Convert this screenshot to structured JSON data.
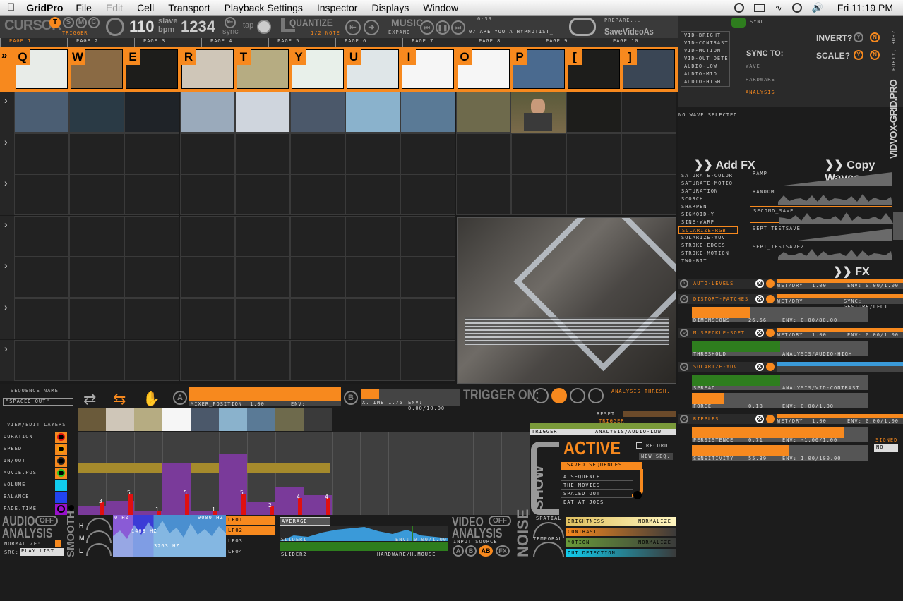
{
  "menubar": {
    "app": "GridPro",
    "items": [
      "File",
      "Edit",
      "Cell",
      "Transport",
      "Playback Settings",
      "Inspector",
      "Displays",
      "Window"
    ],
    "clock": "Fri 11:19 PM"
  },
  "toolbar": {
    "cursor": "CURSOR",
    "modes": [
      "T",
      "S",
      "M",
      "C"
    ],
    "trigger": "TRIGGER",
    "bpm": "110",
    "bpm_units": "slave\nbpm",
    "beats": "1234",
    "sync": "sync",
    "tap": "tap",
    "quantize": "QUANTIZE",
    "quantize_val": "1/2 NOTE",
    "music": "MUSIC",
    "expand": "EXPAND",
    "time": "0:39",
    "track": "07 ARE YOU A HYPNOTIST_",
    "prepare": "PREPARE...",
    "save": "SaveVideoAs"
  },
  "pages": [
    "PAGE 1",
    "PAGE 2",
    "PAGE 3",
    "PAGE 4",
    "PAGE 5",
    "PAGE 6",
    "PAGE 7",
    "PAGE 8",
    "PAGE 9",
    "PAGE 10"
  ],
  "row1_keys": [
    "Q",
    "W",
    "E",
    "R",
    "T",
    "Y",
    "U",
    "I",
    "O",
    "P",
    "[",
    "]"
  ],
  "rows": [
    "2",
    "3",
    "4",
    "5",
    "6",
    "7",
    "8"
  ],
  "sync_panel": {
    "sync": "SYNC",
    "sources": [
      "VID-BRIGHT",
      "VID-CONTRAST",
      "VID-MOTION",
      "VID-OUT_DETE",
      "AUDIO-LOW",
      "AUDIO-MID",
      "AUDIO-HIGH"
    ],
    "sync_to": "SYNC TO:",
    "wave": "WAVE",
    "hardware": "HARDWARE",
    "analysis": "ANALYSIS",
    "invert": "INVERT?",
    "scale": "SCALE?",
    "y": "Y",
    "n": "N",
    "brand": "VIDVOX-GRID.PRO",
    "purty": "PURTY, HUH?",
    "no_wave": "NO WAVE SELECTED"
  },
  "fx": {
    "add_fx": "Add FX",
    "copy_waves": "Copy Waves",
    "list": [
      "SATURATE-COLOR",
      "SATURATE-MOTIO",
      "SATURATION",
      "SCORCH",
      "SHARPEN",
      "SIGMOID-Y",
      "SINE-WARP",
      "SOLARIZE-RGB",
      "SOLARIZE-YUV",
      "STROKE-EDGES",
      "STROKE-MOTION",
      "TWO-BIT"
    ],
    "waves": [
      "RAMP",
      "RANDOM",
      "SECOND_SAVE",
      "SEPT_TESTSAVE",
      "SEPT_TESTSAVE2"
    ],
    "palette": "FX Palette",
    "items": [
      {
        "name": "AUTO-LEVELS",
        "wetdry": "WET/DRY",
        "wd_val": "1.00",
        "env": "ENV: 0.00/1.00",
        "params": []
      },
      {
        "name": "DISTORT-PATCHES",
        "wetdry": "WET/DRY",
        "sync": "SYNC: GESTURE/LFO1",
        "params": [
          {
            "name": "DIMENSIONS",
            "val": "26.56",
            "env": "ENV: 0.00/80.00",
            "fill": 0.33,
            "color": "#f7891e"
          }
        ]
      },
      {
        "name": "M.SPECKLE-SOFT",
        "wetdry": "WET/DRY",
        "wd_val": "1.00",
        "env": "ENV: 0.00/1.00",
        "params": [
          {
            "name": "THRESHOLD",
            "val": "",
            "env": "ANALYSIS/AUDIO-HIGH",
            "fill": 0.5,
            "color": "#2e7d1e"
          }
        ]
      },
      {
        "name": "SOLARIZE-YUV",
        "wetdry": "",
        "wd_val": "",
        "env": "",
        "params": [
          {
            "name": "SPREAD",
            "val": "",
            "env": "ANALYSIS/VID-CONTRAST",
            "fill": 0.5,
            "color": "#2e7d1e"
          },
          {
            "name": "FORCE",
            "val": "0.18",
            "env": "ENV: 0.00/1.00",
            "fill": 0.18,
            "color": "#f7891e"
          }
        ]
      },
      {
        "name": "RIPPLES",
        "wetdry": "WET/DRY",
        "wd_val": "1.00",
        "env": "ENV: 0.00/1.00",
        "params": [
          {
            "name": "PERSISTENCE",
            "val": "0.71",
            "env": "ENV: -1.00/1.00",
            "fill": 0.86,
            "color": "#f7891e"
          },
          {
            "name": "SENSITIVITY",
            "val": "55.39",
            "env": "ENV: 1.00/100.00",
            "fill": 0.55,
            "color": "#f7891e"
          }
        ]
      }
    ],
    "signed": "SIGNED",
    "signed_val": "NO"
  },
  "sequence": {
    "name_label": "SEQUENCE NAME",
    "name": "\"SPACED OUT\"",
    "mixer": "MIXER_POSITION",
    "mixer_val": "1.00",
    "mixer_env": "ENV: 0.00/1.00",
    "xtime": "X.TIME",
    "xtime_val": "1.75",
    "xtime_env": "ENV: 0.00/10.00",
    "trigger_on": "TRIGGER ON:",
    "analysis_thresh": "ANALYSIS THRESH.",
    "a": "A",
    "b": "B",
    "layers_label": "VIEW/EDIT LAYERS",
    "layers": [
      {
        "name": "DURATION",
        "color": "#e01010"
      },
      {
        "name": "SPEED",
        "color": "#f7a000"
      },
      {
        "name": "IN/OUT",
        "color": "#222222"
      },
      {
        "name": "MOVIE.POS",
        "color": "#22cc22"
      },
      {
        "name": "VOLUME",
        "color": "#11ccee"
      },
      {
        "name": "BALANCE",
        "color": "#2244ee"
      },
      {
        "name": "FADE.TIME",
        "color": "#9911cc"
      }
    ],
    "reset": "RESET",
    "trigger": "TRIGGER",
    "trigger_src": "ANALYSIS/AUDIO-LOW",
    "step_values": [
      "3",
      "5",
      "1",
      "5",
      "1",
      "5",
      "2",
      "4",
      "4"
    ]
  },
  "saved": {
    "active": "ACTIVE",
    "show": "SHOW",
    "record": "RECORD",
    "new_seq": "NEW SEQ.",
    "label": "SAVED SEQUENCES",
    "list": [
      "A SEQUENCE",
      "THE MOVIES",
      "SPACED OUT",
      "EAT AT JOES"
    ]
  },
  "audio": {
    "title1": "AUDIO",
    "title2": "ANALYSIS",
    "off": "OFF",
    "smooth": "SMOOTH",
    "normalize": "NORMALIZE:",
    "src": "SRC:",
    "src_val": "PLAY LIST",
    "hz0": "0 HZ",
    "hz9000": "9000 HZ",
    "hz1463": "1463 HZ",
    "hz3263": "3263 HZ",
    "hml": [
      "H",
      "M",
      "L"
    ],
    "lfo": [
      "LFO1",
      "LFO2",
      "LFO3",
      "LFO4"
    ]
  },
  "sliders": {
    "average": "AVERAGE",
    "slider1": "SLIDER1",
    "slider1_env": "ENV: 0.00/1.00",
    "slider2": "SLIDER2",
    "slider2_src": "HARDWARE/H.MOUSE"
  },
  "video": {
    "title1": "VIDEO",
    "title2": "ANALYSIS",
    "off": "OFF",
    "input_source": "INPUT SOURCE",
    "sources": [
      "A",
      "B",
      "AB",
      "FX"
    ],
    "noise": "NOISE",
    "spatial": "SPATIAL",
    "temporal": "TEMPORAL",
    "metrics": [
      {
        "name": "BRIGHTNESS",
        "mode": "NORMALIZE"
      },
      {
        "name": "CONTRAST",
        "mode": ""
      },
      {
        "name": "MOTION",
        "mode": "NORMALIZE"
      },
      {
        "name": "OUT DETECTION",
        "mode": ""
      }
    ]
  }
}
